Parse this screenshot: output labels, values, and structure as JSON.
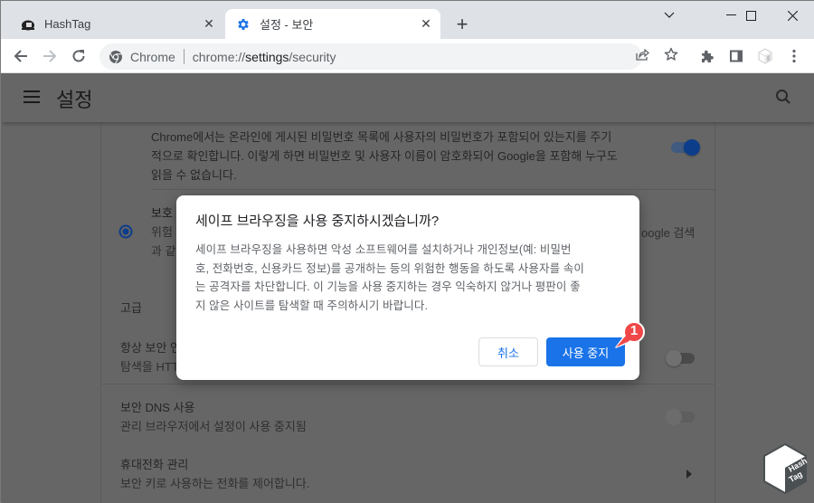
{
  "browser": {
    "tabs": [
      {
        "title": "HashTag",
        "favicon": "hashtag-favicon-icon",
        "active": false
      },
      {
        "title": "설정 - 보안",
        "favicon": "gear-icon",
        "active": true
      }
    ],
    "new_tab_label": "+",
    "omnibox": {
      "chip": "Chrome",
      "url_scheme": "chrome://",
      "url_host": "settings",
      "url_path": "/security"
    }
  },
  "settings": {
    "header_title": "설정",
    "password_check": {
      "description_lines": [
        "Chrome에서는 온라인에 게시된 비밀번호 목록에 사용자의 비밀번호가 포함되어 있는지를 주기",
        "적으로 확인합니다. 이렇게 하면 비밀번호 및 사용자 이름이 암호화되어 Google을 포함해 누구도",
        "읽을 수 없습니다."
      ],
      "toggle_on": true
    },
    "standard_protection": {
      "title_partial": "보호",
      "line1_partial": "위험",
      "line1_tail": "oogle 검색",
      "line2_partial": "과 같"
    },
    "advanced_label": "고급",
    "always_https": {
      "title_partial": "항상 보안 연",
      "subtitle_partial": "탐색을 HTT",
      "toggle_on": false
    },
    "secure_dns": {
      "title": "보안 DNS 사용",
      "subtitle": "관리 브라우저에서 설정이 사용 중지됨",
      "toggle_on": false
    },
    "phone": {
      "title": "휴대전화 관리",
      "subtitle": "보안 키로 사용하는 전화를 제어합니다."
    }
  },
  "dialog": {
    "title": "세이프 브라우징을 사용 중지하시겠습니까?",
    "body_lines": [
      "세이프 브라우징을 사용하면 악성 소프트웨어를 설치하거나 개인정보(예: 비밀번",
      "호, 전화번호, 신용카드 정보)를 공개하는 등의 위험한 행동을 하도록 사용자를 속이",
      "는 공격자를 차단합니다. 이 기능을 사용 중지하는 경우 익숙하지 않거나 평판이 좋",
      "지 않은 사이트를 탐색할 때 주의하시기 바랍니다."
    ],
    "cancel_label": "취소",
    "confirm_label": "사용 중지"
  },
  "annotation": {
    "step_number": "1",
    "color": "#f04848"
  },
  "watermark": {
    "line1": "Hash",
    "line2": "Tag"
  },
  "colors": {
    "accent": "#1a73e8",
    "tabstrip": "#dee1e6",
    "overlay": "#666666"
  }
}
